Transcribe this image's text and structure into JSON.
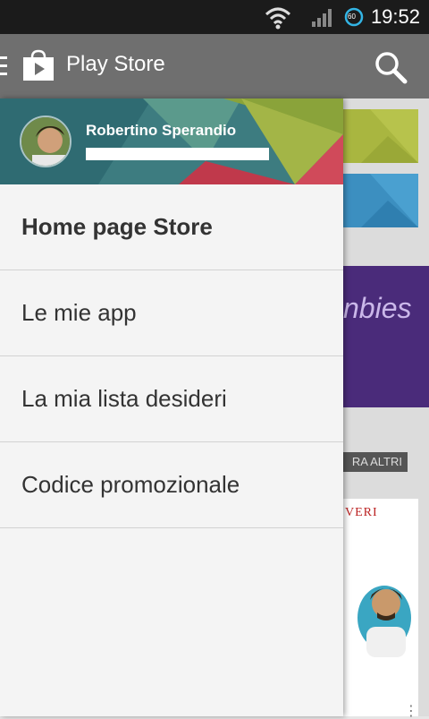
{
  "status_bar": {
    "time": "19:52",
    "battery_level": "60",
    "icons": [
      "wifi-icon",
      "signal-icon",
      "battery-icon"
    ]
  },
  "action_bar": {
    "title": "Play Store",
    "icons": [
      "menu-icon",
      "play-store-logo-icon",
      "search-icon"
    ]
  },
  "drawer": {
    "user": {
      "name": "Robertino Sperandio"
    },
    "items": [
      {
        "label": "Home page Store",
        "active": true
      },
      {
        "label": "Le mie app",
        "active": false
      },
      {
        "label": "La mia lista desideri",
        "active": false
      },
      {
        "label": "Codice promozionale",
        "active": false
      }
    ]
  },
  "background": {
    "promo_text": "nbies",
    "see_more_label": "RA ALTRI",
    "album_text": "VERI"
  },
  "colors": {
    "status_bar": "#1b1b1b",
    "action_bar": "#6f6f6f",
    "drawer": "#f4f4f4",
    "header_teal": "#3d7c80",
    "header_red": "#c0394b",
    "header_green": "#8aa33a",
    "promo": "#4a2b7a"
  }
}
